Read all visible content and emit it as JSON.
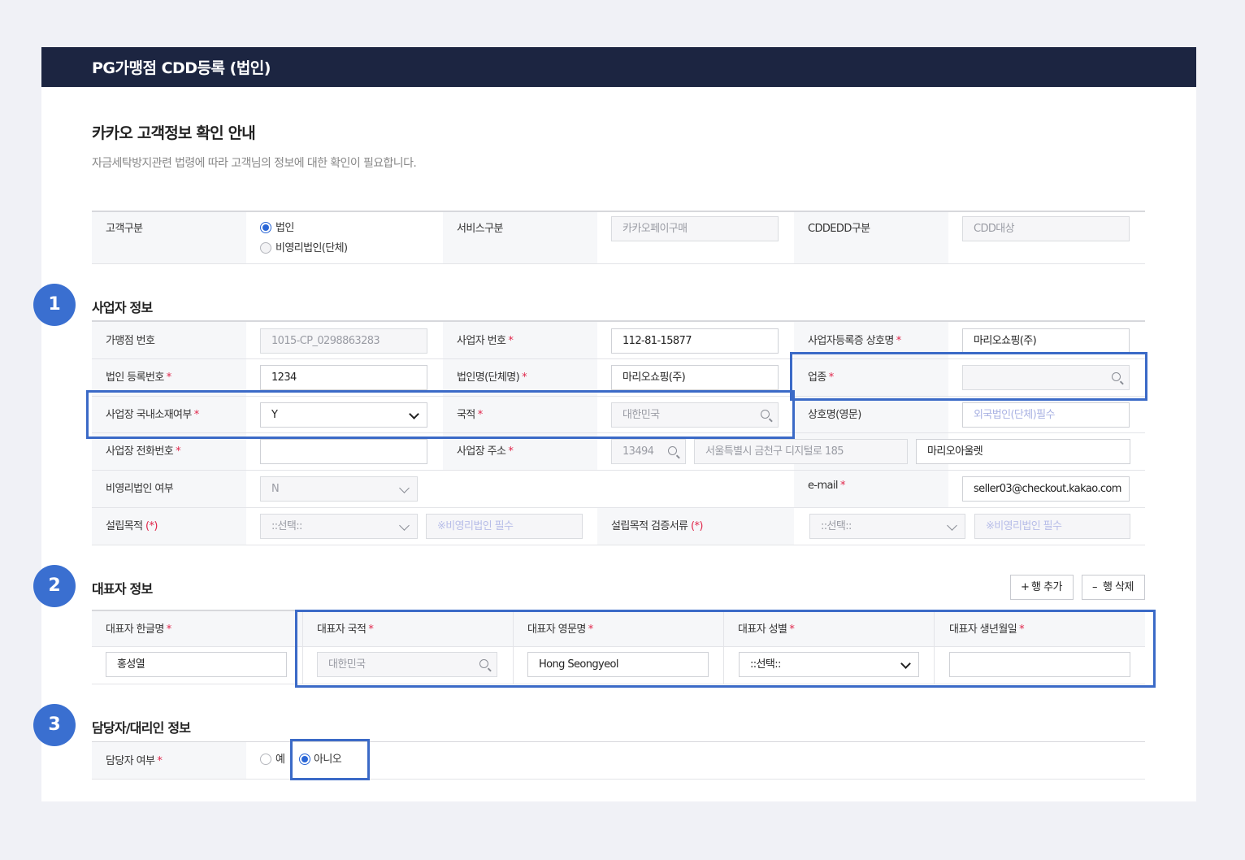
{
  "header": {
    "title": "PG가맹점 CDD등록 (법인)"
  },
  "intro": {
    "title": "카카오 고객정보 확인 안내",
    "subtitle": "자금세탁방지관련 법령에 따라 고객님의 정보에 대한 확인이 필요합니다."
  },
  "customer": {
    "type_label": "고객구분",
    "type_options": [
      {
        "label": "법인",
        "selected": true
      },
      {
        "label": "비영리법인(단체)",
        "selected": false
      }
    ],
    "service_label": "서비스구분",
    "service_value": "카카오페이구매",
    "cdd_label": "CDDEDD구분",
    "cdd_value": "CDD대상"
  },
  "steps": [
    "1",
    "2",
    "3"
  ],
  "business": {
    "title": "사업자 정보",
    "merchant_no_label": "가맹점 번호",
    "merchant_no_value": "1015-CP_0298863283",
    "biz_no_label": "사업자 번호",
    "biz_no_value": "112-81-15877",
    "biz_name_label": "사업자등록증 상호명",
    "biz_name_value": "마리오쇼핑(주)",
    "corp_reg_label": "법인 등록번호",
    "corp_reg_value": "1234",
    "corp_name_label": "법인명(단체명)",
    "corp_name_value": "마리오쇼핑(주)",
    "industry_label": "업종",
    "industry_value": "",
    "domestic_label": "사업장 국내소재여부",
    "domestic_value": "Y",
    "country_label": "국적",
    "country_placeholder": "대한민국",
    "eng_name_label": "상호명(영문)",
    "eng_name_placeholder": "외국법인(단체)필수",
    "phone_label": "사업장 전화번호",
    "phone_value": "",
    "address_label": "사업장 주소",
    "zip_value": "13494",
    "address1_value": "서울특별시 금천구 디지털로 185",
    "address2_value": "마리오아울렛",
    "nonprofit_label": "비영리법인 여부",
    "nonprofit_value": "N",
    "email_label": "e-mail",
    "email_value": "seller03@checkout.kakao.com",
    "purpose_label": "설립목적",
    "purpose_select": "::선택::",
    "purpose_note": "※비영리법인 필수",
    "purpose_doc_label": "설립목적 검증서류",
    "purpose_doc_select": "::선택::",
    "purpose_doc_note": "※비영리법인 필수",
    "required_mark": "*",
    "paren_required_mark": "(*)"
  },
  "representative": {
    "title": "대표자 정보",
    "add_row": "행 추가",
    "delete_row": "행 삭제",
    "add_prefix": "+",
    "delete_prefix": "–",
    "columns": [
      "대표자 한글명",
      "대표자 국적",
      "대표자 영문명",
      "대표자 성별",
      "대표자 생년월일"
    ],
    "korean_name": "홍성열",
    "nationality_placeholder": "대한민국",
    "english_name": "Hong Seongyeol",
    "gender_select": "::선택::",
    "birthdate": ""
  },
  "manager": {
    "title": "담당자/대리인 정보",
    "is_manager_label": "담당자 여부",
    "options": [
      {
        "label": "예",
        "selected": false
      },
      {
        "label": "아니오",
        "selected": true
      }
    ]
  }
}
